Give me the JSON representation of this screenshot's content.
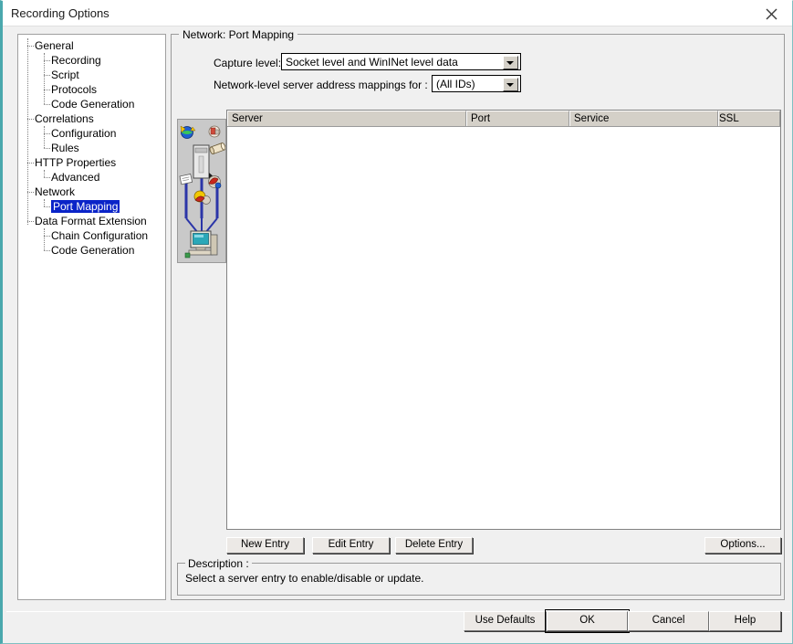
{
  "window": {
    "title": "Recording Options",
    "close_icon": "close-icon"
  },
  "sidebar": {
    "items": [
      {
        "label": "General",
        "level": 0,
        "selected": false
      },
      {
        "label": "Recording",
        "level": 1,
        "selected": false
      },
      {
        "label": "Script",
        "level": 1,
        "selected": false
      },
      {
        "label": "Protocols",
        "level": 1,
        "selected": false
      },
      {
        "label": "Code Generation",
        "level": 1,
        "selected": false
      },
      {
        "label": "Correlations",
        "level": 0,
        "selected": false
      },
      {
        "label": "Configuration",
        "level": 1,
        "selected": false
      },
      {
        "label": "Rules",
        "level": 1,
        "selected": false
      },
      {
        "label": "HTTP Properties",
        "level": 0,
        "selected": false
      },
      {
        "label": "Advanced",
        "level": 1,
        "selected": false
      },
      {
        "label": "Network",
        "level": 0,
        "selected": false
      },
      {
        "label": "Port Mapping",
        "level": 1,
        "selected": true
      },
      {
        "label": "Data Format Extension",
        "level": 0,
        "selected": false
      },
      {
        "label": "Chain Configuration",
        "level": 1,
        "selected": false
      },
      {
        "label": "Code Generation",
        "level": 1,
        "selected": false
      }
    ]
  },
  "main": {
    "group_title": "Network: Port Mapping",
    "capture_level": {
      "label": "Capture level:",
      "value": "Socket level and WinINet level data"
    },
    "address_mappings": {
      "label": "Network-level server address mappings for :",
      "value": "(All IDs)"
    },
    "table": {
      "columns": [
        "Server",
        "Port",
        "Service",
        "SSL"
      ],
      "rows": []
    },
    "entry_buttons": {
      "new_entry": "New Entry",
      "edit_entry": "Edit Entry",
      "delete_entry": "Delete Entry",
      "options": "Options..."
    },
    "description": {
      "title": "Description :",
      "text": "Select a server entry to enable/disable or update."
    }
  },
  "footer": {
    "use_defaults": "Use Defaults",
    "ok": "OK",
    "cancel": "Cancel",
    "help": "Help"
  },
  "colors": {
    "selection_blue": "#0a24c8",
    "window_border_teal": "#4aa8ad",
    "dialog_face": "#f0f0f0",
    "control_face": "#d4d0c8"
  }
}
